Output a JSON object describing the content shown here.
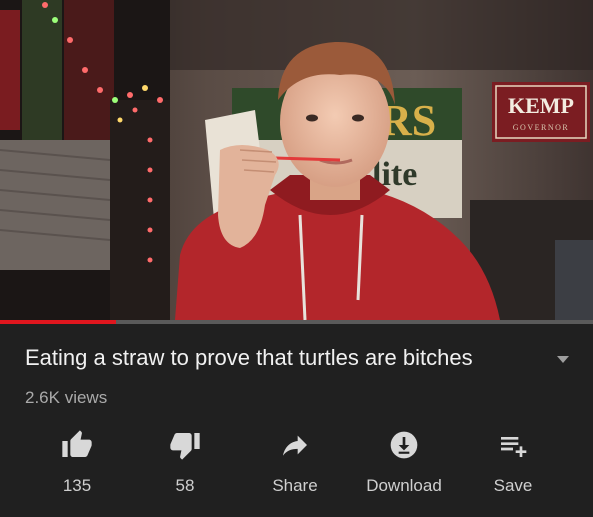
{
  "video": {
    "poster_sign_kemp": "KEMP",
    "poster_sign_governor": "GOVERNOR",
    "poster_rs": "RS",
    "poster_lite": "lite",
    "progress_fraction": 0.195
  },
  "meta": {
    "title": "Eating a straw to prove that turtles are bitches",
    "views": "2.6K views"
  },
  "actions": [
    {
      "icon": "thumbs-up-icon",
      "label": "135"
    },
    {
      "icon": "thumbs-down-icon",
      "label": "58"
    },
    {
      "icon": "share-icon",
      "label": "Share"
    },
    {
      "icon": "download-icon",
      "label": "Download"
    },
    {
      "icon": "save-playlist-icon",
      "label": "Save"
    }
  ],
  "colors": {
    "background": "#202020",
    "progress_played": "#e0161e",
    "icon": "#d8d8d8"
  }
}
